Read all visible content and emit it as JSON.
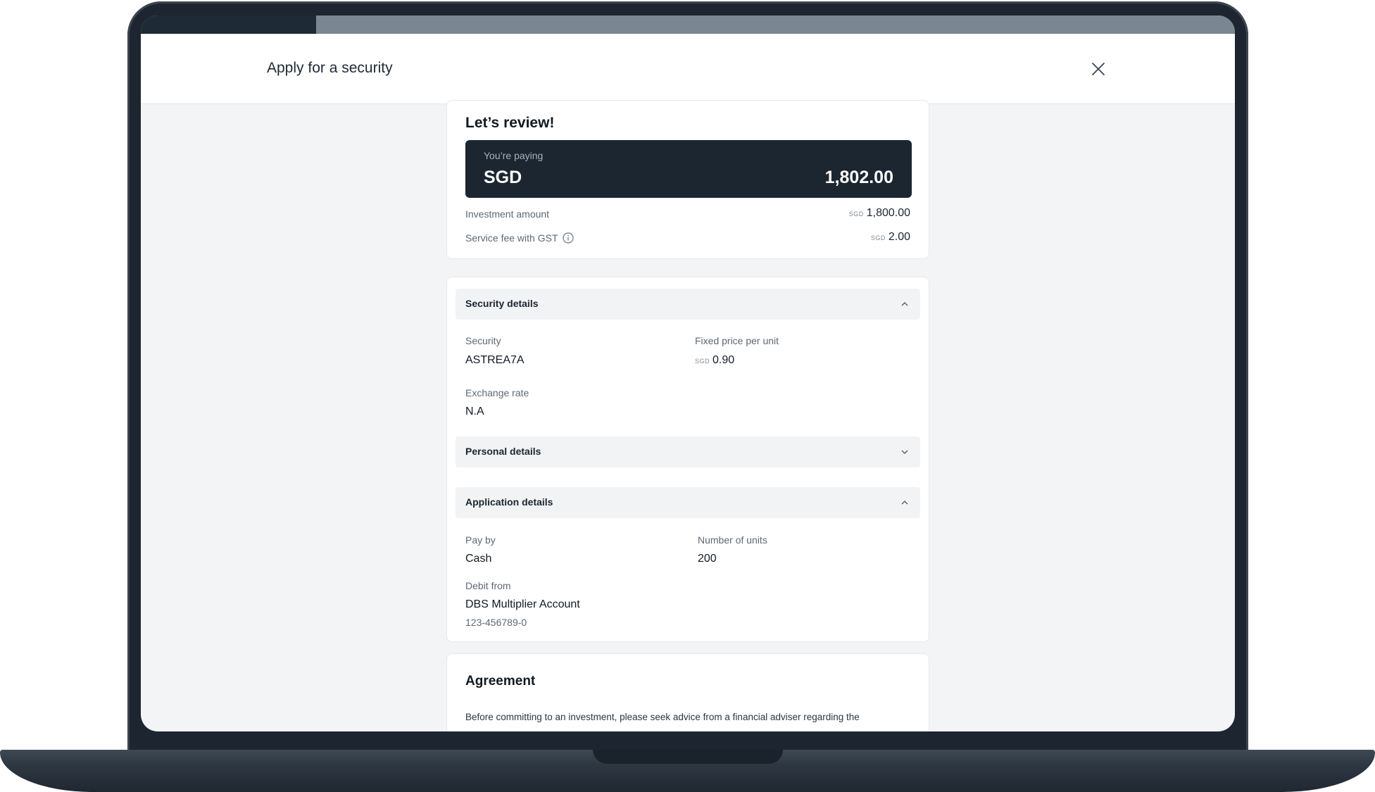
{
  "header": {
    "title": "Apply for a security",
    "progress_fraction": 0.16
  },
  "review": {
    "title": "Let’s review!",
    "paying_label": "You’re paying",
    "paying_currency": "SGD",
    "paying_amount": "1,802.00",
    "rows": [
      {
        "label": "Investment amount",
        "currency": "SGD",
        "value": "1,800.00"
      },
      {
        "label": "Service fee with GST",
        "currency": "SGD",
        "value": "2.00"
      }
    ]
  },
  "security_details": {
    "title": "Security details",
    "expanded": true,
    "security_label": "Security",
    "security_value": "ASTREA7A",
    "price_label": "Fixed price per unit",
    "price_currency": "SGD",
    "price_value": "0.90",
    "exchange_label": "Exchange rate",
    "exchange_value": "N.A"
  },
  "personal_details": {
    "title": "Personal details",
    "expanded": false
  },
  "application_details": {
    "title": "Application details",
    "expanded": true,
    "payby_label": "Pay by",
    "payby_value": "Cash",
    "units_label": "Number of units",
    "units_value": "200",
    "debit_label": "Debit from",
    "debit_value": "DBS Multiplier Account",
    "debit_account": "123-456789-0"
  },
  "agreement": {
    "title": "Agreement",
    "text": "Before committing to an investment, please seek advice from a financial adviser regarding the"
  },
  "colors": {
    "progress_fill": "#1e2a35",
    "progress_track": "#7a8691",
    "pay_box": "#1b2630",
    "background": "#f3f4f6"
  },
  "icons": {
    "close": "close-icon",
    "info": "info-icon",
    "chevron_up": "chevron-up-icon",
    "chevron_down": "chevron-down-icon"
  }
}
